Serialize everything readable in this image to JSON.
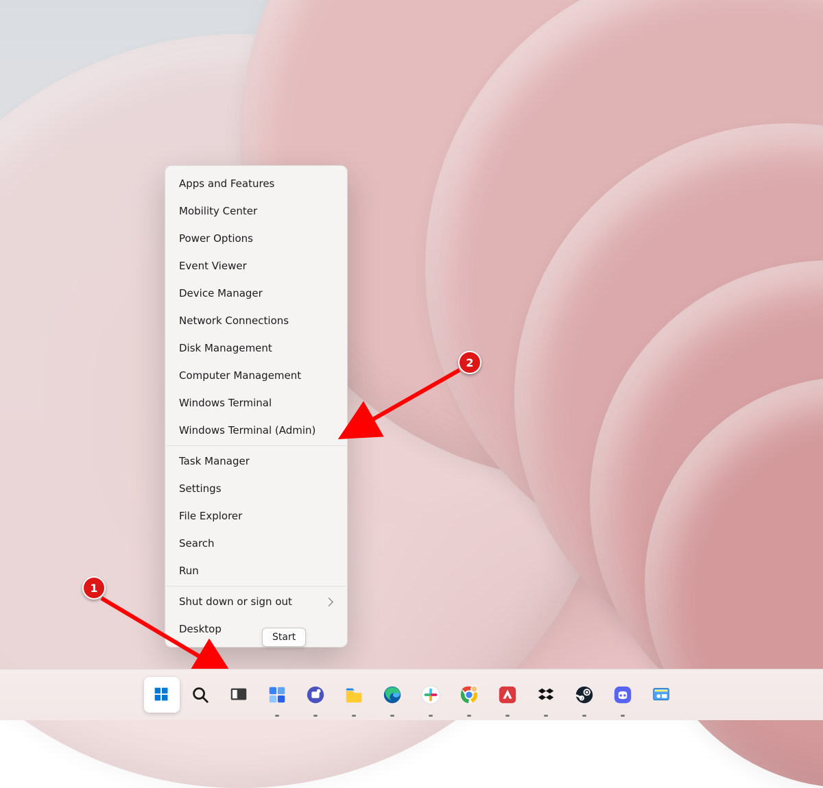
{
  "winx_menu": {
    "groups": [
      [
        "Apps and Features",
        "Mobility Center",
        "Power Options",
        "Event Viewer",
        "Device Manager",
        "Network Connections",
        "Disk Management",
        "Computer Management",
        "Windows Terminal",
        "Windows Terminal (Admin)"
      ],
      [
        "Task Manager",
        "Settings",
        "File Explorer",
        "Search",
        "Run"
      ],
      [
        "Shut down or sign out",
        "Desktop"
      ]
    ],
    "submenu_items": [
      "Shut down or sign out"
    ]
  },
  "tooltip": {
    "text": "Start"
  },
  "annotations": {
    "badge1": "1",
    "badge2": "2"
  },
  "taskbar": {
    "items": [
      {
        "name": "start-button",
        "active": true,
        "indicator": false
      },
      {
        "name": "search-button",
        "active": false,
        "indicator": false
      },
      {
        "name": "task-view-button",
        "active": false,
        "indicator": false
      },
      {
        "name": "widgets-button",
        "active": false,
        "indicator": true
      },
      {
        "name": "teams-chat-button",
        "active": false,
        "indicator": true
      },
      {
        "name": "file-explorer-button",
        "active": false,
        "indicator": true
      },
      {
        "name": "edge-button",
        "active": false,
        "indicator": true
      },
      {
        "name": "slack-button",
        "active": false,
        "indicator": true
      },
      {
        "name": "chrome-button",
        "active": false,
        "indicator": true
      },
      {
        "name": "expressvpn-button",
        "active": false,
        "indicator": true
      },
      {
        "name": "dropbox-button",
        "active": false,
        "indicator": true
      },
      {
        "name": "steam-button",
        "active": false,
        "indicator": true
      },
      {
        "name": "discord-button",
        "active": false,
        "indicator": true
      },
      {
        "name": "control-panel-button",
        "active": false,
        "indicator": false
      }
    ]
  }
}
